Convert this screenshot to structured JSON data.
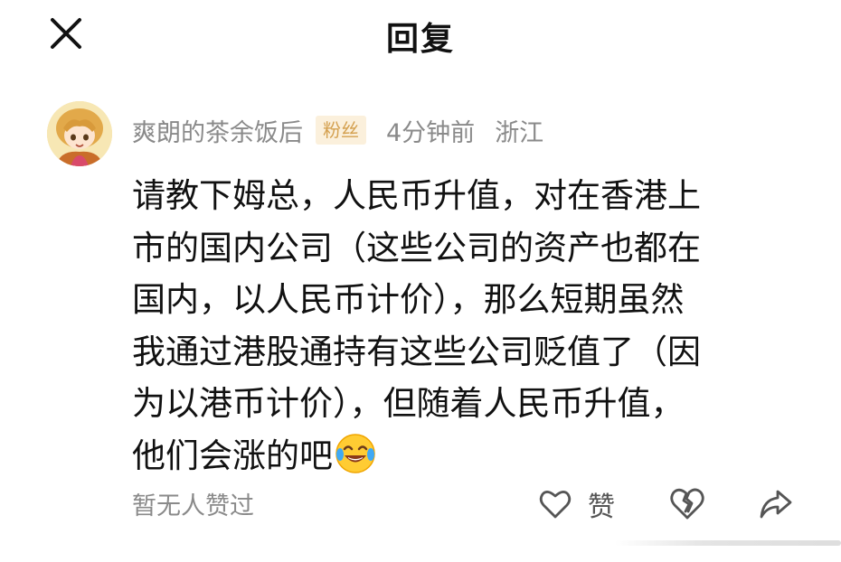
{
  "header": {
    "title": "回复",
    "close_icon": "close-icon"
  },
  "comment": {
    "username": "爽朗的茶余饭后",
    "badge": "粉丝",
    "time": "4分钟前",
    "location": "浙江",
    "content_lines": [
      "请教下姆总，人民币升值，对在香港上",
      "市的国内公司（这些公司的资产也都在",
      "国内，以人民币计价），那么短期虽然",
      "我通过港股通持有这些公司贬值了（因",
      "为以港币计价），但随着人民币升值，",
      "他们会涨的吧"
    ],
    "emoji": "laughing-tears-emoji"
  },
  "actions": {
    "likes_text": "暂无人赞过",
    "like_label": "赞",
    "like_icon": "heart-icon",
    "dislike_icon": "broken-heart-icon",
    "share_icon": "share-icon"
  },
  "colors": {
    "meta_text": "#8a8a8a",
    "badge_bg": "#fbf0dc",
    "badge_text": "#d4a04f"
  }
}
